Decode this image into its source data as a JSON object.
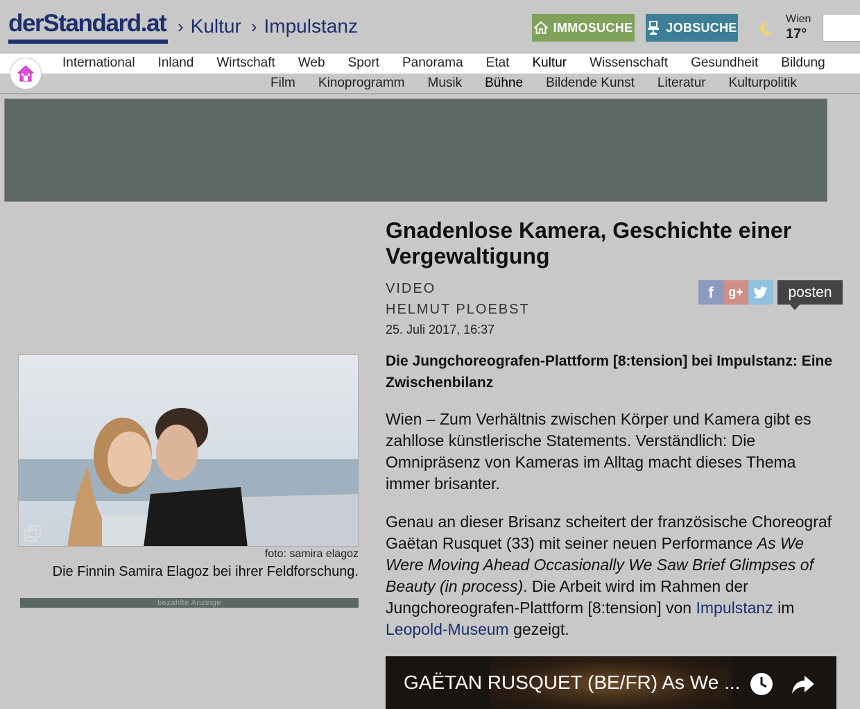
{
  "header": {
    "logo": "derStandard.at",
    "breadcrumb": [
      "Kultur",
      "Impulstanz"
    ],
    "immo_label": "IMMOSUCHE",
    "jobs_label": "JOBSUCHE",
    "weather_city": "Wien",
    "weather_temp": "17°"
  },
  "nav": {
    "items": [
      "International",
      "Inland",
      "Wirtschaft",
      "Web",
      "Sport",
      "Panorama",
      "Etat",
      "Kultur",
      "Wissenschaft",
      "Gesundheit",
      "Bildung"
    ],
    "active": "Kultur"
  },
  "subnav": {
    "items": [
      "Film",
      "Kinoprogramm",
      "Musik",
      "Bühne",
      "Bildende Kunst",
      "Literatur",
      "Kulturpolitik"
    ],
    "active": "Bühne"
  },
  "figure": {
    "credit": "foto: samira elagoz",
    "caption": "Die Finnin Samira Elagoz bei ihrer Feldforschung.",
    "ad_label": "bezahlte Anzeige"
  },
  "article": {
    "headline": "Gnadenlose Kamera, Geschichte einer Vergewaltigung",
    "kicker": "VIDEO",
    "author": "HELMUT PLOEBST",
    "date": "25. Juli 2017, 16:37",
    "lead": "Die Jungchoreografen-Plattform [8:tension] bei Impulstanz: Eine Zwischenbilanz",
    "p1": "Wien – Zum Verhältnis zwischen Körper und Kamera gibt es zahllose künstlerische Statements. Verständlich: Die Omnipräsenz von Kameras im Alltag macht dieses Thema immer brisanter.",
    "p2_a": "Genau an dieser Brisanz scheitert der französische Choreograf Gaëtan Rusquet (33) mit seiner neuen Performance ",
    "p2_title": "As We Were Moving Ahead Occasionally We Saw Brief Glimpses of Beauty (in process)",
    "p2_b": ". Die Arbeit wird im Rahmen der Jungchoreografen-Plattform [8:tension] von ",
    "p2_link1": "Impulstanz",
    "p2_c": " im ",
    "p2_link2": "Leopold-Museum",
    "p2_d": " gezeigt."
  },
  "share": {
    "fb": "f",
    "gp": "g+",
    "posten_label": "posten"
  },
  "video": {
    "title": "GAËTAN RUSQUET (BE/FR) As We ..."
  },
  "colors": {
    "brand": "#1d2f6d",
    "immo": "#7fa35a",
    "jobs": "#3c7f96",
    "ad": "#5b6866"
  }
}
